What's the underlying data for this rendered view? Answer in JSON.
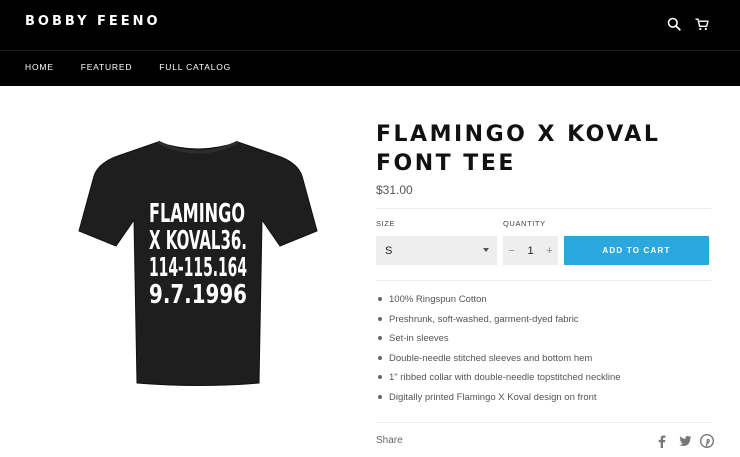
{
  "header": {
    "logo": "BOBBY FEENO",
    "search_icon": "search-icon",
    "cart_icon": "cart-icon"
  },
  "nav": {
    "items": [
      {
        "label": "HOME"
      },
      {
        "label": "FEATURED"
      },
      {
        "label": "FULL CATALOG"
      }
    ]
  },
  "product": {
    "image_text_lines": [
      "FLAMINGO",
      "X KOVAL36.",
      "114-115.164",
      "9.7.1996"
    ],
    "shirt_color": "#1e1e1e",
    "title": "FLAMINGO X KOVAL FONT TEE",
    "price": "$31.00",
    "size_label": "SIZE",
    "size_value": "S",
    "quantity_label": "QUANTITY",
    "quantity_minus": "−",
    "quantity_value": "1",
    "quantity_plus": "+",
    "add_to_cart": "ADD TO CART",
    "features": [
      "100% Ringspun Cotton",
      "Preshrunk, soft-washed, garment-dyed fabric",
      "Set-in sleeves",
      "Double-needle stitched sleeves and bottom hem",
      "1\" ribbed collar with double-needle topstitched neckline",
      "Digitally printed Flamingo X Koval design on front"
    ],
    "share_label": "Share",
    "social_icons": [
      "facebook-icon",
      "twitter-icon",
      "pinterest-icon"
    ]
  },
  "colors": {
    "header_bg": "#000000",
    "accent": "#2da8de",
    "control_bg": "#eeeeee"
  }
}
